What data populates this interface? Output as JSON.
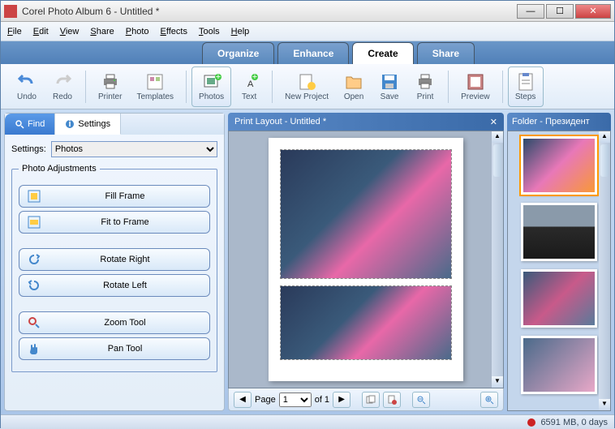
{
  "titlebar": {
    "title": "Corel Photo Album 6 - Untitled *"
  },
  "menu": [
    "File",
    "Edit",
    "View",
    "Share",
    "Photo",
    "Effects",
    "Tools",
    "Help"
  ],
  "main_tabs": {
    "items": [
      "Organize",
      "Enhance",
      "Create",
      "Share"
    ],
    "active": 2
  },
  "toolbar": {
    "undo": "Undo",
    "redo": "Redo",
    "printer": "Printer",
    "templates": "Templates",
    "photos": "Photos",
    "text": "Text",
    "new_project": "New Project",
    "open": "Open",
    "save": "Save",
    "print": "Print",
    "preview": "Preview",
    "steps": "Steps"
  },
  "left": {
    "find_tab": "Find",
    "settings_tab": "Settings",
    "settings_label": "Settings:",
    "settings_value": "Photos",
    "group_title": "Photo Adjustments",
    "buttons": {
      "fill": "Fill Frame",
      "fit": "Fit to Frame",
      "rot_right": "Rotate Right",
      "rot_left": "Rotate Left",
      "zoom": "Zoom Tool",
      "pan": "Pan Tool"
    }
  },
  "canvas": {
    "title": "Print Layout - Untitled *",
    "page_label": "Page",
    "page_num": "1",
    "page_of": "of 1"
  },
  "right": {
    "folder": "Folder - Президент"
  },
  "status": {
    "text": "6591 MB, 0 days"
  }
}
